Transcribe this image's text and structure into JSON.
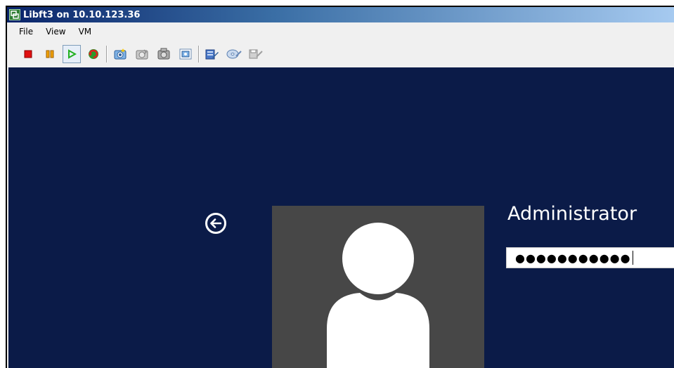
{
  "window": {
    "title": "Libft3 on 10.10.123.36"
  },
  "menu": {
    "items": [
      "File",
      "View",
      "VM"
    ]
  },
  "toolbar": {
    "buttons": [
      {
        "icon": "stop-icon",
        "color": "#e01010"
      },
      {
        "icon": "pause-icon",
        "color": "#f0a000"
      },
      {
        "icon": "play-icon",
        "color": "#20b020",
        "active": true
      },
      {
        "icon": "reset-icon",
        "color": "#d02020"
      },
      {
        "icon": "snapshot-take-icon"
      },
      {
        "icon": "snapshot-revert-icon"
      },
      {
        "icon": "snapshot-manager-icon"
      },
      {
        "icon": "edit-settings-icon"
      },
      {
        "icon": "cd-dvd-icon"
      },
      {
        "icon": "floppy-icon"
      }
    ]
  },
  "login": {
    "username": "Administrator",
    "password_mask": "●●●●●●●●●●●",
    "background_color": "#0b1b48",
    "avatar_bg": "#474747"
  }
}
